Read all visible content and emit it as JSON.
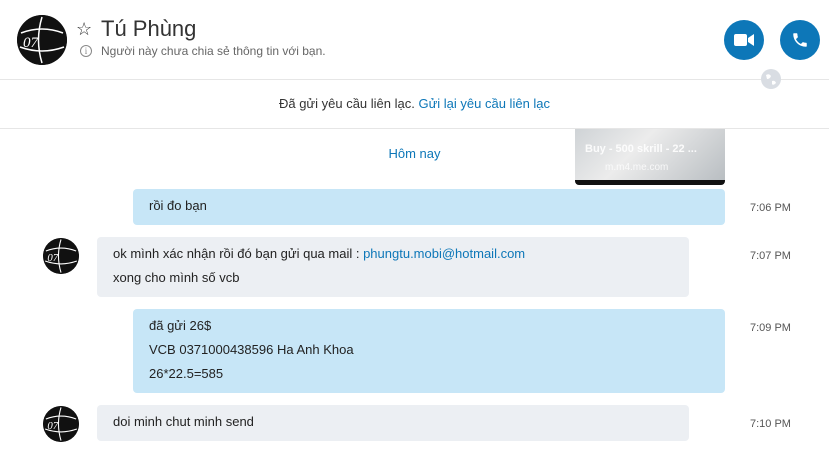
{
  "header": {
    "contact_name": "Tú Phùng",
    "status": "Người này chưa chia sẻ thông tin với bạn.",
    "avatar_text": "07"
  },
  "request": {
    "text": "Đã gửi yêu cầu liên lạc.",
    "link": "Gửi lại yêu cầu liên lạc"
  },
  "attachment": {
    "caption": "Buy - 500 skrill - 22 ...",
    "sub": "m.m4.me.com"
  },
  "day_label": "Hôm nay",
  "messages": [
    {
      "direction": "out",
      "lines": [
        "rồi đo bạn"
      ],
      "time": "7:06 PM"
    },
    {
      "direction": "in",
      "line1_prefix": "ok mình xác nhận rồi đó bạn gửi qua mail : ",
      "email": "phungtu.mobi@hotmail.com",
      "line2": "xong cho mình số vcb",
      "time": "7:07 PM"
    },
    {
      "direction": "out",
      "lines": [
        "đã gửi 26$",
        "VCB 0371000438596 Ha Anh Khoa",
        "26*22.5=585"
      ],
      "time": "7:09 PM"
    },
    {
      "direction": "in",
      "lines": [
        "doi minh chut minh send"
      ],
      "time": "7:10 PM"
    }
  ],
  "colors": {
    "accent": "#0d77b8",
    "outgoing_bubble": "#c7e6f7",
    "incoming_bubble": "#eceff3"
  },
  "icons": [
    "star-icon",
    "info-icon",
    "video-call-icon",
    "phone-icon",
    "globe-icon"
  ]
}
